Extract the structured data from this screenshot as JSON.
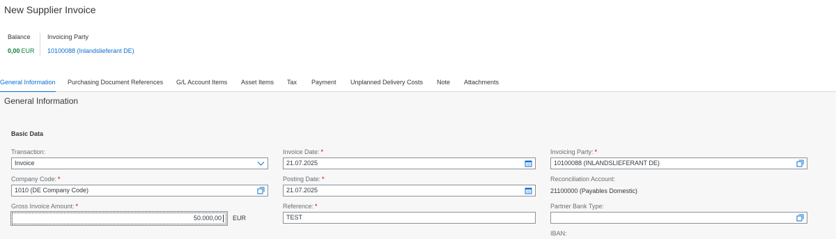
{
  "header": {
    "title": "New Supplier Invoice",
    "balance": {
      "label": "Balance",
      "value": "0,00",
      "currency": "EUR",
      "color": "#107e3e"
    },
    "invoicing_party": {
      "label": "Invoicing Party",
      "value": "10100088 (Inlandslieferant DE)"
    }
  },
  "tabs": [
    {
      "label": "General Information",
      "active": true
    },
    {
      "label": "Purchasing Document References"
    },
    {
      "label": "G/L Account Items"
    },
    {
      "label": "Asset Items"
    },
    {
      "label": "Tax"
    },
    {
      "label": "Payment"
    },
    {
      "label": "Unplanned Delivery Costs"
    },
    {
      "label": "Note"
    },
    {
      "label": "Attachments"
    }
  ],
  "section": {
    "title": "General Information",
    "group_title": "Basic Data"
  },
  "form": {
    "transaction": {
      "label": "Transaction:",
      "value": "Invoice",
      "icon": "chevron-down-icon"
    },
    "company_code": {
      "label": "Company Code:",
      "required": "*",
      "value": "1010 (DE Company Code)",
      "icon": "value-help-icon"
    },
    "gross_amount": {
      "label": "Gross Invoice Amount:",
      "required": "*",
      "value": "50.000,00",
      "currency": "EUR"
    },
    "invoice_date": {
      "label": "Invoice Date:",
      "required": "*",
      "value": "21.07.2025",
      "icon": "calendar-icon"
    },
    "posting_date": {
      "label": "Posting Date:",
      "required": "*",
      "value": "21.07.2025",
      "icon": "calendar-icon"
    },
    "reference": {
      "label": "Reference:",
      "required": "*",
      "value": "TEST"
    },
    "invoicing_party": {
      "label": "Invoicing Party:",
      "required": "*",
      "value": "10100088 (INLANDSLIEFERANT DE)",
      "icon": "value-help-icon"
    },
    "reconciliation_account": {
      "label": "Reconciliation Account:",
      "value": "21100000 (Payables Domestic)"
    },
    "partner_bank_type": {
      "label": "Partner Bank Type:",
      "value": "",
      "icon": "value-help-icon"
    },
    "iban": {
      "label": "IBAN:"
    }
  },
  "colors": {
    "accent": "#0a6ed1",
    "positive": "#107e3e",
    "required": "#bb0000"
  }
}
